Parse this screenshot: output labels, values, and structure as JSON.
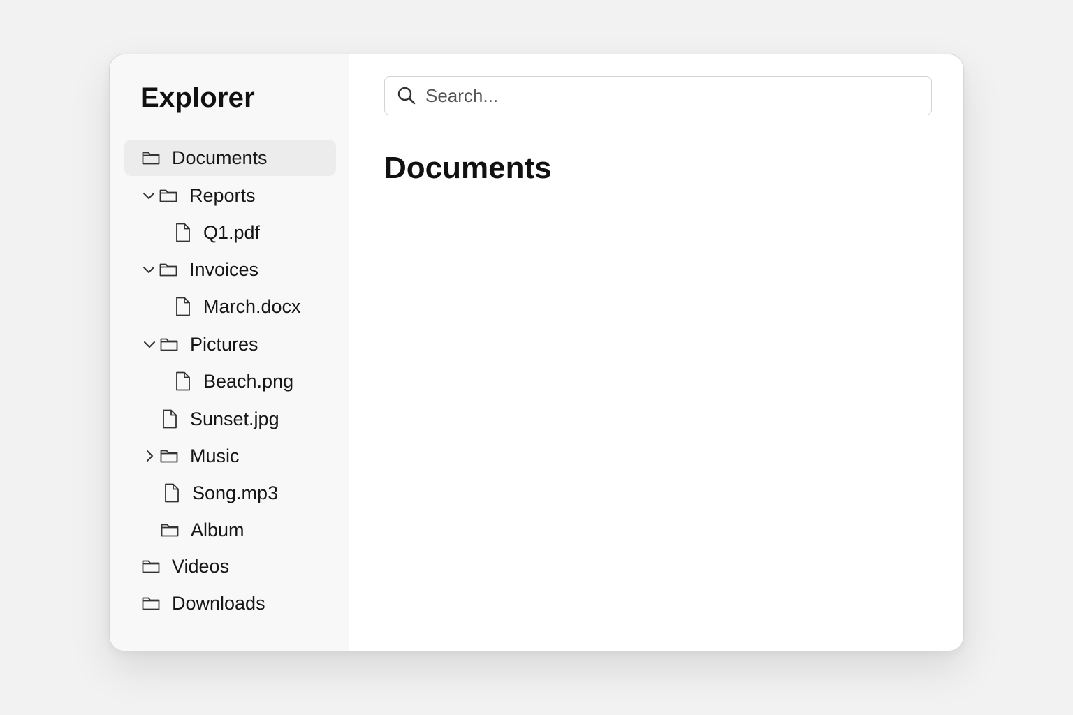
{
  "sidebar": {
    "title": "Explorer",
    "items": [
      {
        "label": "Documents",
        "icon": "folder-icon",
        "selected": true
      },
      {
        "label": "Reports",
        "icon": "folder-icon",
        "expanded": true,
        "chevron": "chevron-down-icon"
      },
      {
        "label": "Q1.pdf",
        "icon": "file-icon"
      },
      {
        "label": "Invoices",
        "icon": "folder-icon",
        "expanded": true,
        "chevron": "chevron-down-icon"
      },
      {
        "label": "March.docx",
        "icon": "file-icon"
      },
      {
        "label": "Pictures",
        "icon": "folder-icon",
        "expanded": true,
        "chevron": "chevron-down-icon"
      },
      {
        "label": "Beach.png",
        "icon": "file-icon"
      },
      {
        "label": "Sunset.jpg",
        "icon": "file-icon"
      },
      {
        "label": "Music",
        "icon": "folder-icon",
        "expanded": false,
        "chevron": "chevron-right-icon"
      },
      {
        "label": "Song.mp3",
        "icon": "file-icon"
      },
      {
        "label": "Album",
        "icon": "folder-icon"
      },
      {
        "label": "Videos",
        "icon": "folder-icon"
      },
      {
        "label": "Downloads",
        "icon": "folder-icon"
      }
    ]
  },
  "search": {
    "placeholder": "Search...",
    "value": ""
  },
  "main": {
    "title": "Documents"
  },
  "colors": {
    "selected_bg": "#ececec",
    "sidebar_bg": "#f8f8f8",
    "text": "#161616"
  }
}
